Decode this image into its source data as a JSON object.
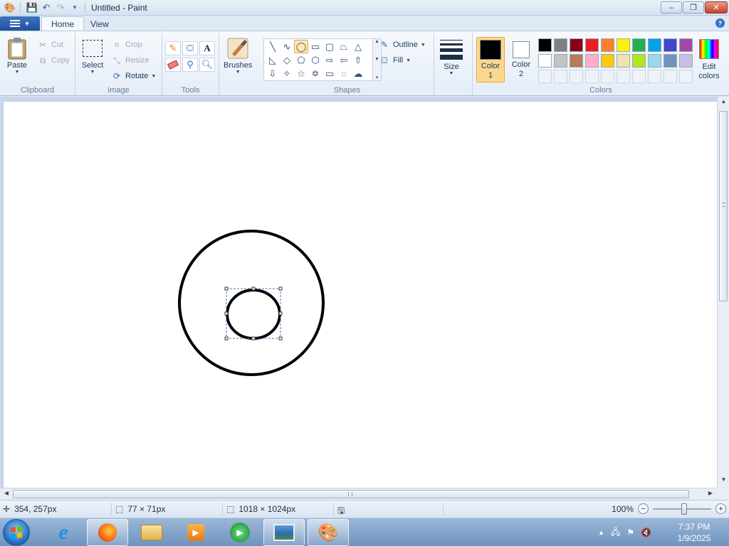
{
  "window": {
    "title": "Untitled - Paint",
    "controls": {
      "minimize": "–",
      "restore": "❐",
      "close": "✕"
    }
  },
  "tabs": {
    "home": "Home",
    "view": "View"
  },
  "ribbon": {
    "clipboard": {
      "label": "Clipboard",
      "paste": "Paste",
      "cut": "Cut",
      "copy": "Copy"
    },
    "image": {
      "label": "Image",
      "select": "Select",
      "crop": "Crop",
      "resize": "Resize",
      "rotate": "Rotate"
    },
    "tools": {
      "label": "Tools"
    },
    "brushes": {
      "label": "Brushes"
    },
    "shapes": {
      "label": "Shapes",
      "outline": "Outline",
      "fill": "Fill",
      "selected_shape": "oval"
    },
    "size": {
      "label": "Size"
    },
    "colors": {
      "label": "Colors",
      "color1_line1": "Color",
      "color1_line2": "1",
      "color2_line1": "Color",
      "color2_line2": "2",
      "edit_line1": "Edit",
      "edit_line2": "colors",
      "color1_value": "#000000",
      "color2_value": "#ffffff",
      "palette_row1": [
        "#000000",
        "#7f7f7f",
        "#880015",
        "#ed1c24",
        "#ff7f27",
        "#fff200",
        "#22b14c",
        "#00a2e8",
        "#3f48cc",
        "#a349a4"
      ],
      "palette_row2": [
        "#ffffff",
        "#c3c3c3",
        "#b97a57",
        "#ffaec9",
        "#ffc90e",
        "#efe4b0",
        "#b5e61d",
        "#99d9ea",
        "#7092be",
        "#c8bfe7"
      ]
    }
  },
  "status": {
    "cursor_pos": "354, 257px",
    "selection_size": "77 × 71px",
    "image_size": "1018 × 1024px",
    "zoom": "100%"
  },
  "taskbar": {
    "time": "7:37 PM",
    "date": "1/9/2025"
  }
}
